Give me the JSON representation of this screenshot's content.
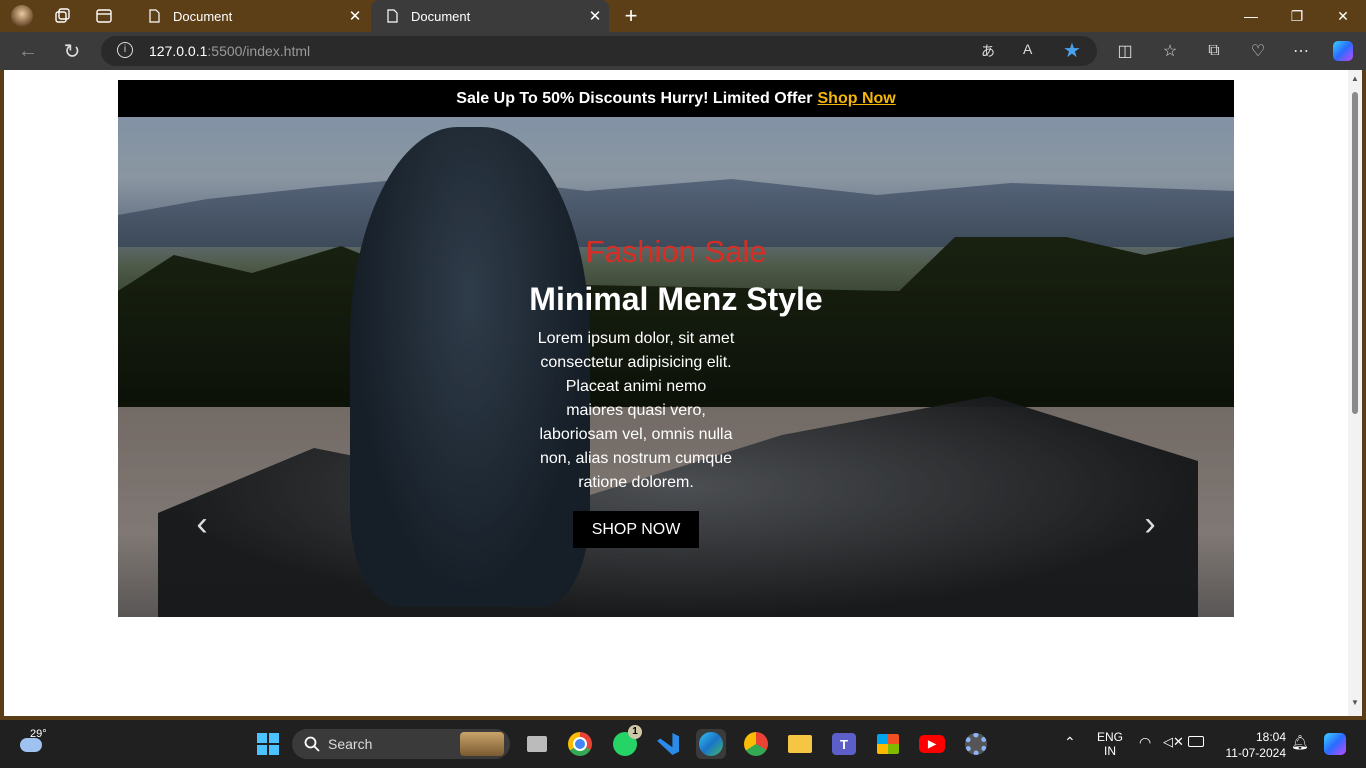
{
  "browser": {
    "tabs": [
      {
        "label": "Document"
      },
      {
        "label": "Document"
      }
    ],
    "url_host": "127.0.0.1",
    "url_rest": ":5500/index.html"
  },
  "page": {
    "announcement": {
      "text": "Sale Up To 50% Discounts Hurry! Limited Offer",
      "link": "Shop Now",
      "link_color": "#f5b60a"
    },
    "hero": {
      "eyebrow": "Fashion Sale",
      "eyebrow_color": "#d82d24",
      "heading": "Minimal Menz Style",
      "description": "Lorem ipsum dolor, sit amet consectetur adipisicing elit. Placeat animi nemo maiores quasi vero, laboriosam vel, omnis nulla non, alias nostrum cumque ratione dolorem.",
      "button": "SHOP NOW",
      "prev_arrow": "‹",
      "next_arrow": "›"
    }
  },
  "taskbar": {
    "weather": "29°",
    "search_label": "Search",
    "whatsapp_badge": "1",
    "teams_letter": "T",
    "lang_line1": "ENG",
    "lang_line2": "IN",
    "time": "18:04",
    "date": "11-07-2024"
  }
}
